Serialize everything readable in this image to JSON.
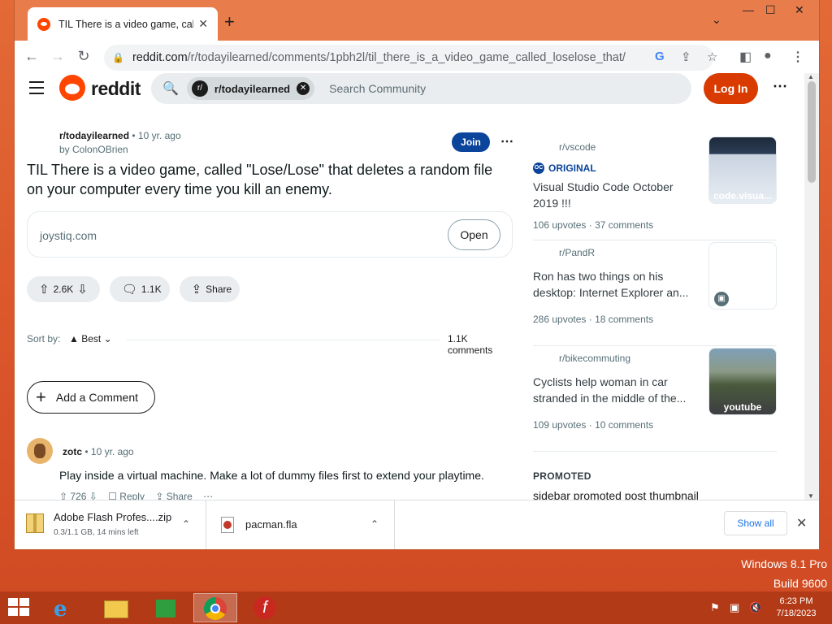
{
  "browser": {
    "tab_title": "TIL There is a video game, called",
    "url_host": "reddit.com",
    "url_path": "/r/todayilearned/comments/1pbh2l/til_there_is_a_video_game_called_loselose_that/"
  },
  "reddit": {
    "logo_text": "reddit",
    "search_chip": "r/todayilearned",
    "search_placeholder": "Search Community",
    "login_label": "Log In"
  },
  "post": {
    "subreddit": "r/todayilearned",
    "age": "10 yr. ago",
    "author": "by ColonOBrien",
    "join_label": "Join",
    "title": "TIL There is a video game, called \"Lose/Lose\" that deletes a random file on your computer every time you kill an enemy.",
    "link_domain": "joystiq.com",
    "open_label": "Open",
    "score": "2.6K",
    "comments_count": "1.1K",
    "share_label": "Share",
    "sort_label": "Sort by:",
    "sort_value": "Best",
    "comments_total": "1.1K comments",
    "add_comment_label": "Add a Comment"
  },
  "comment": {
    "author": "zotc",
    "age": "10 yr. ago",
    "text": "Play inside a virtual machine. Make a lot of dummy files first to extend your playtime.",
    "score": "726",
    "reply_label": "Reply",
    "share_label": "Share"
  },
  "sidebar": {
    "items": [
      {
        "subreddit": "r/vscode",
        "badge": "ORIGINAL",
        "title": "Visual Studio Code October 2019 !!!",
        "upvotes": "106 upvotes",
        "comments": "37 comments",
        "thumb_caption": "code.visua..."
      },
      {
        "subreddit": "r/PandR",
        "title": "Ron has two things on his desktop: Internet Explorer an...",
        "upvotes": "286 upvotes",
        "comments": "18 comments"
      },
      {
        "subreddit": "r/bikecommuting",
        "title": "Cyclists help woman in car stranded in the middle of the...",
        "upvotes": "109 upvotes",
        "comments": "10 comments",
        "thumb_caption": "youtube"
      }
    ],
    "promoted_label": "PROMOTED",
    "promoted_alt": "sidebar promoted post thumbnail"
  },
  "downloads": {
    "items": [
      {
        "name": "Adobe Flash Profes....zip",
        "status": "0.3/1.1 GB, 14 mins left"
      },
      {
        "name": "pacman.fla"
      }
    ],
    "show_all": "Show all"
  },
  "os": {
    "edition": "Windows 8.1 Pro",
    "build": "Build 9600",
    "time": "6:23 PM",
    "date": "7/18/2023"
  },
  "colors": {
    "reddit_orange": "#ff4500",
    "login_red": "#d93a00",
    "join_blue": "#0a449b",
    "desktop": "#d9542a"
  }
}
